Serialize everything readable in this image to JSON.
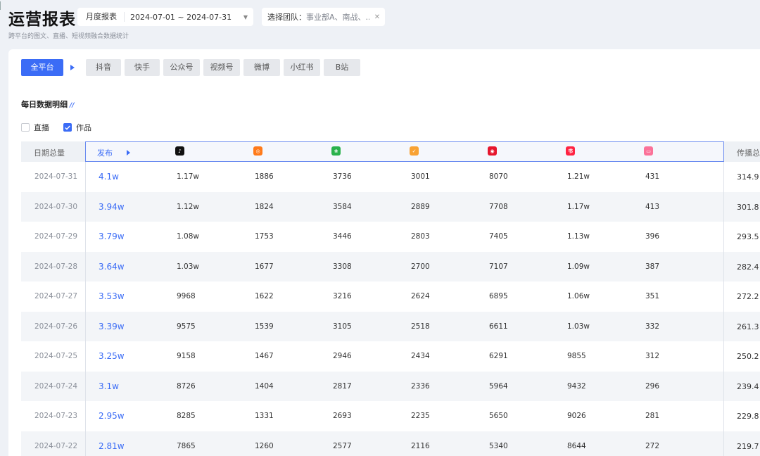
{
  "header": {
    "title": "运营报表",
    "subtitle": "跨平台的图文、直播、短视频融合数据统计",
    "period_label": "月度报表",
    "date_range": "2024-07-01 ~ 2024-07-31",
    "team_label": "选择团队：",
    "team_value": "事业部A、南战、...",
    "team_clear_icon": "close-icon"
  },
  "tabs": [
    {
      "label": "全平台",
      "active": true
    },
    {
      "label": "抖音"
    },
    {
      "label": "快手"
    },
    {
      "label": "公众号"
    },
    {
      "label": "视频号"
    },
    {
      "label": "微博"
    },
    {
      "label": "小红书"
    },
    {
      "label": "B站"
    }
  ],
  "section": {
    "title": "每日数据明细",
    "mark": "//"
  },
  "filters": [
    {
      "label": "直播",
      "checked": false
    },
    {
      "label": "作品",
      "checked": true
    }
  ],
  "table": {
    "date_header": "日期总量",
    "publish_header": "发布",
    "spread_header": "传播总量",
    "platform_icons": [
      {
        "name": "douyin-icon",
        "color": "#111111",
        "glyph": "♪"
      },
      {
        "name": "kuaishou-icon",
        "color": "#ff7a1a",
        "glyph": "◎"
      },
      {
        "name": "wechat-channels-icon",
        "color": "#2bb24c",
        "glyph": "❀"
      },
      {
        "name": "official-account-icon",
        "color": "#f8a234",
        "glyph": "✓"
      },
      {
        "name": "weibo-icon",
        "color": "#e6162d",
        "glyph": "◉"
      },
      {
        "name": "xiaohongshu-icon",
        "color": "#ff2442",
        "glyph": "书"
      },
      {
        "name": "bilibili-icon",
        "color": "#fb7299",
        "glyph": "▭"
      }
    ],
    "rows": [
      {
        "date": "2024-07-31",
        "publish": "4.1w",
        "values": [
          "1.17w",
          "1886",
          "3736",
          "3001",
          "8070",
          "1.21w",
          "431"
        ],
        "spread": "314.9"
      },
      {
        "date": "2024-07-30",
        "publish": "3.94w",
        "values": [
          "1.12w",
          "1824",
          "3584",
          "2889",
          "7708",
          "1.17w",
          "413"
        ],
        "spread": "301.8"
      },
      {
        "date": "2024-07-29",
        "publish": "3.79w",
        "values": [
          "1.08w",
          "1753",
          "3446",
          "2803",
          "7405",
          "1.13w",
          "396"
        ],
        "spread": "293.5"
      },
      {
        "date": "2024-07-28",
        "publish": "3.64w",
        "values": [
          "1.03w",
          "1677",
          "3308",
          "2700",
          "7107",
          "1.09w",
          "387"
        ],
        "spread": "282.4"
      },
      {
        "date": "2024-07-27",
        "publish": "3.53w",
        "values": [
          "9968",
          "1622",
          "3216",
          "2624",
          "6895",
          "1.06w",
          "351"
        ],
        "spread": "272.2"
      },
      {
        "date": "2024-07-26",
        "publish": "3.39w",
        "values": [
          "9575",
          "1539",
          "3105",
          "2518",
          "6611",
          "1.03w",
          "332"
        ],
        "spread": "261.3"
      },
      {
        "date": "2024-07-25",
        "publish": "3.25w",
        "values": [
          "9158",
          "1467",
          "2946",
          "2434",
          "6291",
          "9855",
          "312"
        ],
        "spread": "250.2"
      },
      {
        "date": "2024-07-24",
        "publish": "3.1w",
        "values": [
          "8726",
          "1404",
          "2817",
          "2336",
          "5964",
          "9432",
          "296"
        ],
        "spread": "239.4"
      },
      {
        "date": "2024-07-23",
        "publish": "2.95w",
        "values": [
          "8285",
          "1331",
          "2693",
          "2235",
          "5650",
          "9026",
          "281"
        ],
        "spread": "229.8"
      },
      {
        "date": "2024-07-22",
        "publish": "2.81w",
        "values": [
          "7865",
          "1260",
          "2577",
          "2116",
          "5340",
          "8644",
          "272"
        ],
        "spread": "219.7"
      }
    ]
  },
  "colors": {
    "accent": "#3b6cf6",
    "row_alt": "#f3f5f8",
    "header_bg": "#eef1f5"
  }
}
